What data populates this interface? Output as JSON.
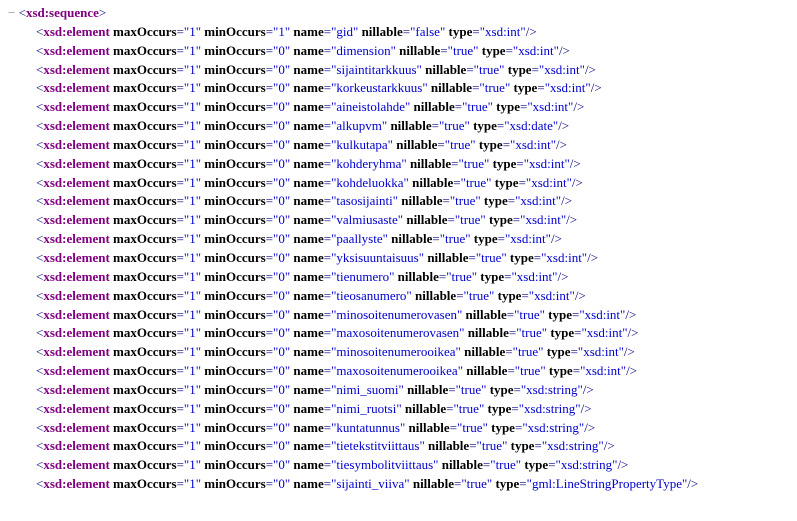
{
  "toggle": "−",
  "open_lt": "<",
  "close_gt": ">",
  "selfclose_gt": "/>",
  "eq": "=",
  "parent_tag": "xsd:sequence",
  "child_tag": "xsd:element",
  "attr_names": {
    "maxOccurs": "maxOccurs",
    "minOccurs": "minOccurs",
    "name": "name",
    "nillable": "nillable",
    "type": "type"
  },
  "elements": [
    {
      "maxOccurs": "\"1\"",
      "minOccurs": "\"1\"",
      "name": "\"gid\"",
      "nillable": "\"false\"",
      "type": "\"xsd:int\""
    },
    {
      "maxOccurs": "\"1\"",
      "minOccurs": "\"0\"",
      "name": "\"dimension\"",
      "nillable": "\"true\"",
      "type": "\"xsd:int\""
    },
    {
      "maxOccurs": "\"1\"",
      "minOccurs": "\"0\"",
      "name": "\"sijaintitarkkuus\"",
      "nillable": "\"true\"",
      "type": "\"xsd:int\""
    },
    {
      "maxOccurs": "\"1\"",
      "minOccurs": "\"0\"",
      "name": "\"korkeustarkkuus\"",
      "nillable": "\"true\"",
      "type": "\"xsd:int\""
    },
    {
      "maxOccurs": "\"1\"",
      "minOccurs": "\"0\"",
      "name": "\"aineistolahde\"",
      "nillable": "\"true\"",
      "type": "\"xsd:int\""
    },
    {
      "maxOccurs": "\"1\"",
      "minOccurs": "\"0\"",
      "name": "\"alkupvm\"",
      "nillable": "\"true\"",
      "type": "\"xsd:date\""
    },
    {
      "maxOccurs": "\"1\"",
      "minOccurs": "\"0\"",
      "name": "\"kulkutapa\"",
      "nillable": "\"true\"",
      "type": "\"xsd:int\""
    },
    {
      "maxOccurs": "\"1\"",
      "minOccurs": "\"0\"",
      "name": "\"kohderyhma\"",
      "nillable": "\"true\"",
      "type": "\"xsd:int\""
    },
    {
      "maxOccurs": "\"1\"",
      "minOccurs": "\"0\"",
      "name": "\"kohdeluokka\"",
      "nillable": "\"true\"",
      "type": "\"xsd:int\""
    },
    {
      "maxOccurs": "\"1\"",
      "minOccurs": "\"0\"",
      "name": "\"tasosijainti\"",
      "nillable": "\"true\"",
      "type": "\"xsd:int\""
    },
    {
      "maxOccurs": "\"1\"",
      "minOccurs": "\"0\"",
      "name": "\"valmiusaste\"",
      "nillable": "\"true\"",
      "type": "\"xsd:int\""
    },
    {
      "maxOccurs": "\"1\"",
      "minOccurs": "\"0\"",
      "name": "\"paallyste\"",
      "nillable": "\"true\"",
      "type": "\"xsd:int\""
    },
    {
      "maxOccurs": "\"1\"",
      "minOccurs": "\"0\"",
      "name": "\"yksisuuntaisuus\"",
      "nillable": "\"true\"",
      "type": "\"xsd:int\""
    },
    {
      "maxOccurs": "\"1\"",
      "minOccurs": "\"0\"",
      "name": "\"tienumero\"",
      "nillable": "\"true\"",
      "type": "\"xsd:int\""
    },
    {
      "maxOccurs": "\"1\"",
      "minOccurs": "\"0\"",
      "name": "\"tieosanumero\"",
      "nillable": "\"true\"",
      "type": "\"xsd:int\""
    },
    {
      "maxOccurs": "\"1\"",
      "minOccurs": "\"0\"",
      "name": "\"minosoitenumerovasen\"",
      "nillable": "\"true\"",
      "type": "\"xsd:int\""
    },
    {
      "maxOccurs": "\"1\"",
      "minOccurs": "\"0\"",
      "name": "\"maxosoitenumerovasen\"",
      "nillable": "\"true\"",
      "type": "\"xsd:int\""
    },
    {
      "maxOccurs": "\"1\"",
      "minOccurs": "\"0\"",
      "name": "\"minosoitenumerooikea\"",
      "nillable": "\"true\"",
      "type": "\"xsd:int\""
    },
    {
      "maxOccurs": "\"1\"",
      "minOccurs": "\"0\"",
      "name": "\"maxosoitenumerooikea\"",
      "nillable": "\"true\"",
      "type": "\"xsd:int\""
    },
    {
      "maxOccurs": "\"1\"",
      "minOccurs": "\"0\"",
      "name": "\"nimi_suomi\"",
      "nillable": "\"true\"",
      "type": "\"xsd:string\""
    },
    {
      "maxOccurs": "\"1\"",
      "minOccurs": "\"0\"",
      "name": "\"nimi_ruotsi\"",
      "nillable": "\"true\"",
      "type": "\"xsd:string\""
    },
    {
      "maxOccurs": "\"1\"",
      "minOccurs": "\"0\"",
      "name": "\"kuntatunnus\"",
      "nillable": "\"true\"",
      "type": "\"xsd:string\""
    },
    {
      "maxOccurs": "\"1\"",
      "minOccurs": "\"0\"",
      "name": "\"tietekstitviittaus\"",
      "nillable": "\"true\"",
      "type": "\"xsd:string\""
    },
    {
      "maxOccurs": "\"1\"",
      "minOccurs": "\"0\"",
      "name": "\"tiesymbolitviittaus\"",
      "nillable": "\"true\"",
      "type": "\"xsd:string\""
    },
    {
      "maxOccurs": "\"1\"",
      "minOccurs": "\"0\"",
      "name": "\"sijainti_viiva\"",
      "nillable": "\"true\"",
      "type": "\"gml:LineStringPropertyType\""
    }
  ]
}
